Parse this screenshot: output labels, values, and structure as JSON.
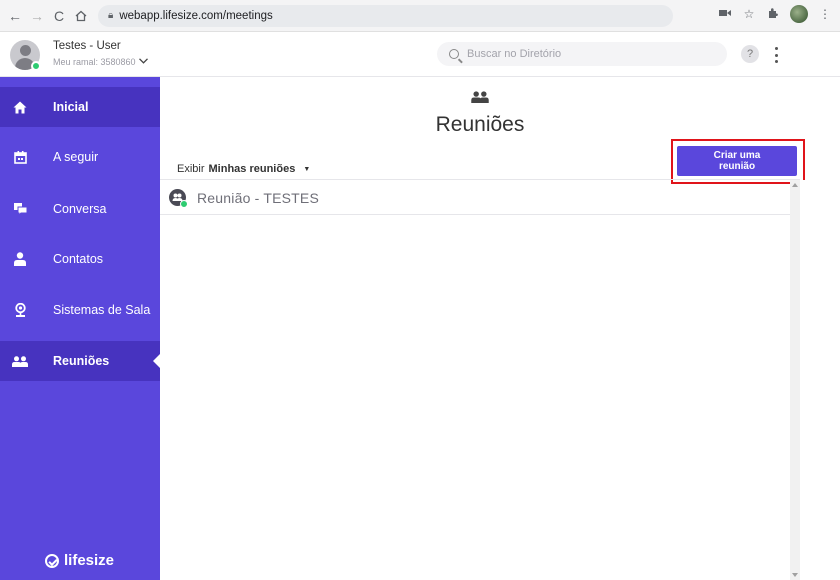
{
  "browser": {
    "url": "webapp.lifesize.com/meetings"
  },
  "header": {
    "user_name": "Testes - User",
    "user_extension": "Meu ramal: 3580860",
    "search_placeholder": "Buscar no Diretório",
    "help_label": "?"
  },
  "sidebar": {
    "items": [
      {
        "label": "Inicial",
        "icon": "home-icon"
      },
      {
        "label": "A seguir",
        "icon": "calendar-icon"
      },
      {
        "label": "Conversa",
        "icon": "chat-icon"
      },
      {
        "label": "Contatos",
        "icon": "contact-icon"
      },
      {
        "label": "Sistemas de Sala",
        "icon": "room-system-icon"
      },
      {
        "label": "Reuniões",
        "icon": "meetings-icon"
      }
    ],
    "active_item": "Reuniões",
    "brand": "lifesize"
  },
  "main": {
    "title": "Reuniões",
    "filter_prefix": "Exibir",
    "filter_value": "Minhas reuniões",
    "create_button": "Criar uma\nreunião",
    "meetings": [
      {
        "name": "Reunião - TESTES"
      }
    ]
  },
  "colors": {
    "sidebar": "#5a47dc",
    "sidebar_active": "#4733bf",
    "highlight_border": "#e0141a",
    "status_online": "#2ecc71"
  }
}
